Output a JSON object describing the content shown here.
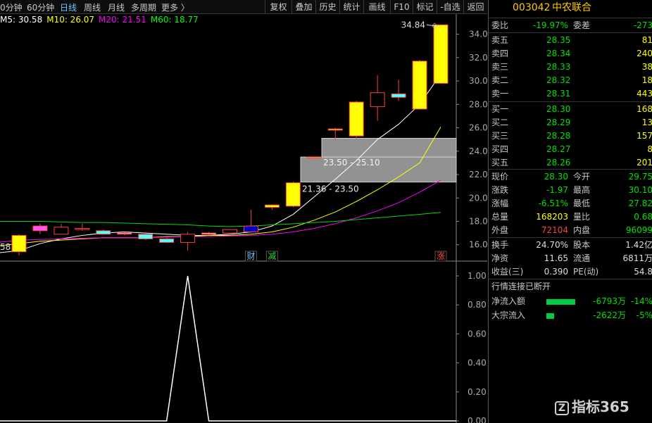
{
  "toolbar": {
    "periods": [
      "0分钟",
      "60分钟",
      "日线",
      "周线",
      "月线",
      "多周期",
      "更多 〉"
    ],
    "active_period": "日线",
    "buttons": [
      "复权",
      "叠加",
      "历史",
      "统计",
      "画线",
      "F10",
      "标记",
      "-自选",
      "返回"
    ]
  },
  "ma_legend": [
    {
      "label": "M5: 30.58",
      "color": "#ffffff"
    },
    {
      "label": "M10: 26.07",
      "color": "#ffff00"
    },
    {
      "label": "M20: 21.51",
      "color": "#ff00ff"
    },
    {
      "label": "M60: 18.77",
      "color": "#00ff00"
    }
  ],
  "chart_data": [
    {
      "type": "candlestick",
      "y_axis_ticks": [
        "34.00",
        "32.00",
        "30.00",
        "28.00",
        "26.00",
        "24.00",
        "22.00",
        "20.00",
        "18.00",
        "16.00"
      ],
      "ylim": [
        14.6,
        35.6
      ],
      "candles": [
        {
          "o": 15.4,
          "h": 16.9,
          "l": 15.1,
          "c": 16.8,
          "fill": "#ffff00"
        },
        {
          "o": 17.2,
          "h": 17.8,
          "l": 16.9,
          "c": 17.6,
          "fill": "#ff55ff"
        },
        {
          "o": 17.5,
          "h": 17.8,
          "l": 16.9,
          "c": 16.9,
          "fill": "#000"
        },
        {
          "o": 17.4,
          "h": 17.8,
          "l": 17.2,
          "c": 17.3,
          "fill": "#000"
        },
        {
          "o": 17.2,
          "h": 17.3,
          "l": 17.1,
          "c": 16.9,
          "fill": "#55ffff"
        },
        {
          "o": 17.0,
          "h": 17.1,
          "l": 16.8,
          "c": 17.0,
          "fill": "#ffffff"
        },
        {
          "o": 16.9,
          "h": 17.1,
          "l": 16.4,
          "c": 16.5,
          "fill": "#55ffff"
        },
        {
          "o": 16.5,
          "h": 16.6,
          "l": 16.2,
          "c": 16.2,
          "fill": "#55ffff"
        },
        {
          "o": 16.2,
          "h": 17.1,
          "l": 15.5,
          "c": 16.9,
          "fill": "#000"
        },
        {
          "o": 16.9,
          "h": 17.1,
          "l": 16.8,
          "c": 17.0,
          "fill": "#ffffff"
        },
        {
          "o": 17.0,
          "h": 17.3,
          "l": 16.9,
          "c": 17.3,
          "fill": "#000"
        },
        {
          "o": 17.1,
          "h": 19.0,
          "l": 17.0,
          "c": 17.6,
          "fill": "#0000cc"
        },
        {
          "o": 19.2,
          "h": 19.4,
          "l": 19.0,
          "c": 19.4,
          "fill": "#ffff00"
        },
        {
          "o": 19.3,
          "h": 21.4,
          "l": 19.2,
          "c": 21.3,
          "fill": "#ffff00"
        },
        {
          "o": 23.5,
          "h": 23.5,
          "l": 23.5,
          "c": 23.5,
          "fill": "#ffff00"
        },
        {
          "o": 25.8,
          "h": 26.0,
          "l": 25.0,
          "c": 25.9,
          "fill": "#ffff00"
        },
        {
          "o": 25.3,
          "h": 28.3,
          "l": 25.0,
          "c": 28.2,
          "fill": "#ffff00"
        },
        {
          "o": 27.8,
          "h": 30.5,
          "l": 26.6,
          "c": 29.0,
          "fill": "#000"
        },
        {
          "o": 28.9,
          "h": 30.1,
          "l": 28.3,
          "c": 28.6,
          "fill": "#55ffff"
        },
        {
          "o": 27.6,
          "h": 31.8,
          "l": 27.6,
          "c": 31.7,
          "fill": "#ffff00"
        },
        {
          "o": 29.8,
          "h": 34.8,
          "l": 29.8,
          "c": 34.8,
          "fill": "#ffff00"
        }
      ],
      "gaps": [
        {
          "low": 21.36,
          "high": 23.5,
          "label": "21.36 - 23.50"
        },
        {
          "low": 23.5,
          "high": 25.1,
          "label": "23.50 - 25.10"
        }
      ],
      "high_label": "34.84",
      "left_low_label": "58",
      "markers": [
        {
          "candle": 11,
          "text": "财",
          "color": "#6fc3ff"
        },
        {
          "candle": 12,
          "text": "减",
          "color": "#33dd33"
        },
        {
          "candle": 20,
          "text": "涨",
          "color": "#ff4444"
        }
      ],
      "ma_lines": {
        "M5": [
          15.5,
          16.1,
          16.5,
          16.8,
          17.0,
          17.1,
          17.0,
          16.9,
          16.8,
          16.8,
          16.9,
          17.1,
          17.6,
          18.6,
          20.1,
          21.6,
          23.2,
          25.0,
          26.3,
          28.0,
          30.58
        ],
        "M10": [
          16.1,
          16.3,
          16.4,
          16.5,
          16.6,
          16.6,
          16.6,
          16.7,
          16.7,
          16.8,
          16.8,
          16.9,
          17.1,
          17.5,
          18.1,
          18.8,
          19.7,
          20.7,
          21.8,
          23.0,
          26.07
        ],
        "M20": [
          16.4,
          16.45,
          16.5,
          16.55,
          16.6,
          16.6,
          16.6,
          16.65,
          16.7,
          16.7,
          16.75,
          16.8,
          16.9,
          17.1,
          17.4,
          17.8,
          18.3,
          18.9,
          19.6,
          20.5,
          21.51
        ],
        "M60": [
          18.0,
          18.0,
          17.95,
          17.9,
          17.9,
          17.85,
          17.8,
          17.75,
          17.7,
          17.6,
          17.55,
          17.6,
          17.7,
          17.8,
          17.9,
          18.0,
          18.15,
          18.3,
          18.45,
          18.6,
          18.77
        ]
      }
    },
    {
      "type": "line",
      "y_axis_ticks": [
        "1.00",
        "0.80",
        "0.60",
        "0.40",
        "0.20",
        "0.00"
      ],
      "ylim": [
        0,
        1
      ],
      "x": [
        0,
        1,
        2,
        3,
        4,
        5,
        6,
        7,
        8,
        9,
        10,
        11,
        12,
        13,
        14,
        15,
        16,
        17,
        18,
        19,
        20
      ],
      "values": [
        0,
        0,
        0,
        0,
        0,
        0,
        0,
        0,
        1,
        0,
        0,
        0,
        0,
        0,
        0,
        0,
        0,
        0,
        0,
        0,
        0
      ]
    }
  ],
  "quote": {
    "code": "003042",
    "name": "中农联合",
    "weibi": {
      "label": "委比",
      "value": "-19.97%",
      "label2": "委差",
      "value2": "-273"
    },
    "asks": [
      {
        "label": "卖五",
        "price": "28.35",
        "vol": "81"
      },
      {
        "label": "卖四",
        "price": "28.34",
        "vol": "240"
      },
      {
        "label": "卖三",
        "price": "28.33",
        "vol": "38"
      },
      {
        "label": "卖二",
        "price": "28.32",
        "vol": "18"
      },
      {
        "label": "卖一",
        "price": "28.31",
        "vol": "443"
      }
    ],
    "bids": [
      {
        "label": "买一",
        "price": "28.30",
        "vol": "168"
      },
      {
        "label": "买二",
        "price": "28.29",
        "vol": "13"
      },
      {
        "label": "买三",
        "price": "28.28",
        "vol": "157"
      },
      {
        "label": "买四",
        "price": "28.27",
        "vol": "8"
      },
      {
        "label": "买五",
        "price": "28.26",
        "vol": "201"
      }
    ],
    "stats": [
      {
        "l1": "现价",
        "v1": "28.30",
        "c1": "#00e000",
        "l2": "今开",
        "v2": "29.75",
        "c2": "#00e000"
      },
      {
        "l1": "涨跌",
        "v1": "-1.97",
        "c1": "#00e000",
        "l2": "最高",
        "v2": "30.10",
        "c2": "#00e000"
      },
      {
        "l1": "涨幅",
        "v1": "-6.51%",
        "c1": "#00e000",
        "l2": "最低",
        "v2": "27.82",
        "c2": "#00e000"
      },
      {
        "l1": "总量",
        "v1": "168203",
        "c1": "#ffff00",
        "l2": "量比",
        "v2": "0.68",
        "c2": "#00e000"
      },
      {
        "l1": "外盘",
        "v1": "72104",
        "c1": "#ff4040",
        "l2": "内盘",
        "v2": "96099",
        "c2": "#00e000"
      }
    ],
    "fin": [
      {
        "l1": "换手",
        "v1": "24.70%",
        "l2": "股本",
        "v2": "1.42亿"
      },
      {
        "l1": "净资",
        "v1": "11.65",
        "l2": "流通",
        "v2": "6811万"
      },
      {
        "l1": "收益(三)",
        "v1": "0.390",
        "l2": "PE(动)",
        "v2": "54.8"
      }
    ],
    "status": "行情连接已断开",
    "flows": [
      {
        "label": "净流入额",
        "value": "-6793万",
        "pct": "-14%",
        "bar": 0.78
      },
      {
        "label": "大宗流入",
        "value": "-2622万",
        "pct": "-5%",
        "bar": 0.22
      }
    ]
  },
  "watermark": "指标365",
  "colors": {
    "up": "#ff4040",
    "down": "#00e000",
    "gap_box": "#9a9a9a",
    "axis": "#aaaaaa"
  }
}
